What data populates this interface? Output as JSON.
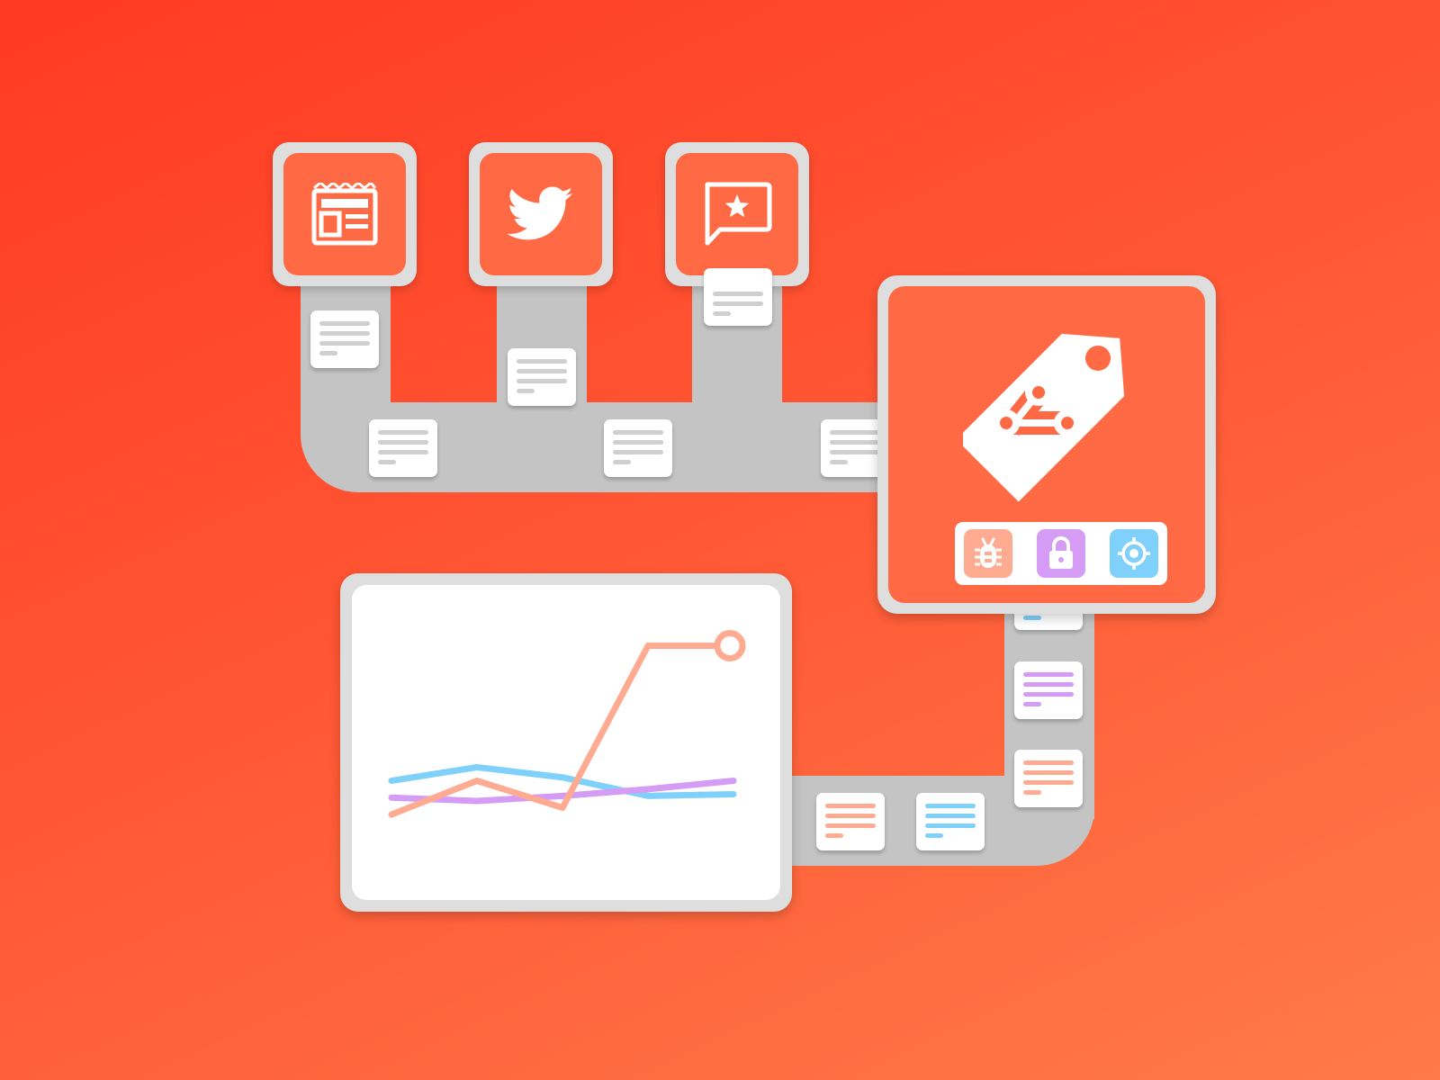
{
  "colors": {
    "background_start": "#ff3a22",
    "background_end": "#ff7a48",
    "card_orange": "#ff6a44",
    "frame_gray": "#dedede",
    "belt_gray": "#c4c4c4",
    "doc_line_gray": "#cfcfcf"
  },
  "sources": [
    {
      "name": "news",
      "icon": "newspaper-icon"
    },
    {
      "name": "twitter",
      "icon": "twitter-bird-icon"
    },
    {
      "name": "reviews",
      "icon": "review-star-chat-icon"
    }
  ],
  "processor": {
    "icon": "price-tag-icon",
    "badges": [
      {
        "icon": "bug-icon",
        "color": "#ffab92"
      },
      {
        "icon": "lock-icon",
        "color": "#d59cf5"
      },
      {
        "icon": "target-icon",
        "color": "#7fd1fb"
      }
    ]
  },
  "doc_card_colors": {
    "gray": "#cfcfcf",
    "blue": "#7fd1fb",
    "purple": "#d59cf5",
    "salmon": "#ffab92"
  },
  "chart_data": {
    "type": "line",
    "x": [
      0,
      1,
      2,
      3,
      4
    ],
    "series": [
      {
        "color": "#7fd1fb",
        "values": [
          3.0,
          3.4,
          3.1,
          2.55,
          2.6
        ]
      },
      {
        "color": "#d59cf5",
        "values": [
          2.5,
          2.4,
          2.55,
          2.75,
          3.0
        ]
      },
      {
        "color": "#ffab92",
        "values": [
          2.0,
          3.0,
          2.2,
          7.0,
          7.0
        ],
        "highlight_last": true
      }
    ],
    "xlim": [
      0,
      4
    ],
    "ylim": [
      0,
      8
    ],
    "grid": false,
    "axes": false
  }
}
